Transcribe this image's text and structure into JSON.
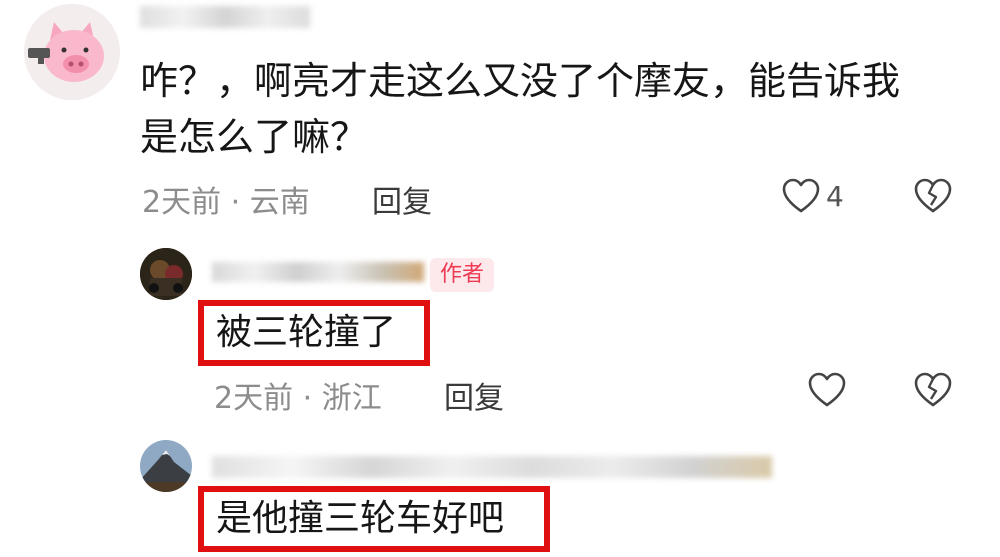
{
  "comments": [
    {
      "text_line1": "咋？，啊亮才走这么又没了个摩友，能告诉我",
      "text_line2": "是怎么了嘛？",
      "time_location": "2天前 · 云南",
      "reply_label": "回复",
      "like_count": "4"
    },
    {
      "author_tag": "作者",
      "text": "被三轮撞了",
      "time_location": "2天前 · 浙江",
      "reply_label": "回复"
    },
    {
      "text": "是他撞三轮车好吧"
    }
  ]
}
